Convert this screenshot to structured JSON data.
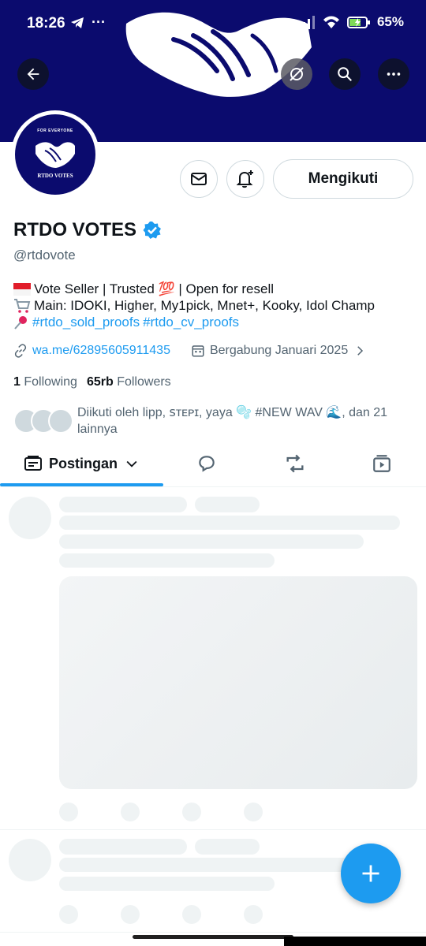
{
  "status_bar": {
    "time": "18:26",
    "battery": "65%"
  },
  "header": {
    "back_icon": "arrow-left-icon",
    "hide_icon": "eye-slash-icon",
    "search_icon": "search-icon",
    "more_icon": "more-dots-icon"
  },
  "avatar": {
    "tagline": "FOR EVERYONE",
    "name": "RTDO VOTES"
  },
  "actions": {
    "follow_label": "Mengikuti"
  },
  "profile": {
    "display_name": "RTDO VOTES",
    "handle": "@rtdovote",
    "verified": true,
    "bio_line1": "Vote Seller | Trusted 💯 | Open for resell",
    "bio_line2": "Main: IDOKI, Higher, My1pick, Mnet+, Kooky, Idol Champ",
    "bio_hashtag1": "#rtdo_sold_proofs",
    "bio_hashtag2": "#rtdo_cv_proofs",
    "link": "wa.me/62895605911435",
    "joined": "Bergabung Januari 2025",
    "following_count": "1",
    "following_label": "Following",
    "followers_count": "65rb",
    "followers_label": "Followers",
    "followed_by_text": "Diikuti oleh lipp, ꜱᴛᴇᴘɪ, yaya 🫧 #NEW WAV 🌊, dan 21 lainnya"
  },
  "tabs": {
    "posts_label": "Postingan"
  },
  "colors": {
    "banner": "#0b0b6e",
    "accent": "#1d9bf0"
  }
}
